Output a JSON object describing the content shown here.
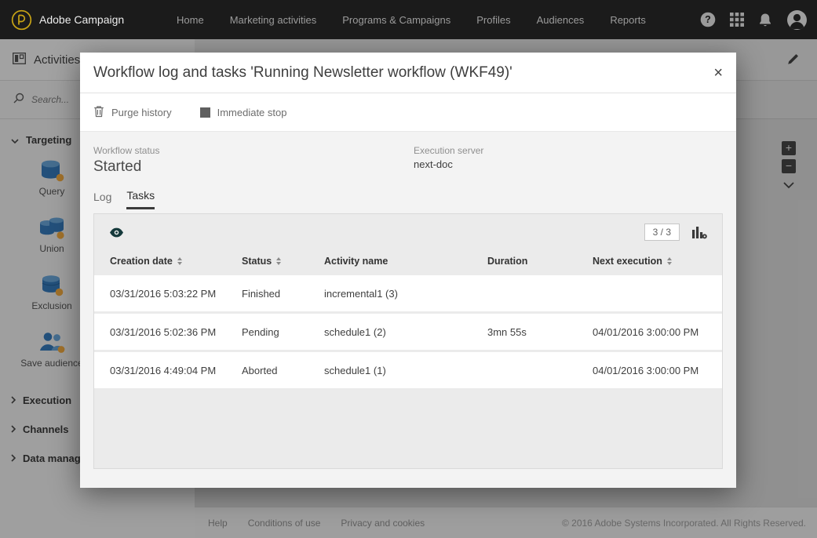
{
  "colors": {
    "topbar_bg": "#1b1b1b",
    "logo_gold": "#c8a415",
    "accent_blue": "#2e74b5",
    "accent_orange": "#f0a63a",
    "tab_active_underline": "#3a3a3a"
  },
  "topbar": {
    "brand": "Adobe Campaign",
    "nav": [
      {
        "label": "Home"
      },
      {
        "label": "Marketing activities"
      },
      {
        "label": "Programs & Campaigns"
      },
      {
        "label": "Profiles"
      },
      {
        "label": "Audiences"
      },
      {
        "label": "Reports"
      }
    ]
  },
  "sidebar": {
    "title": "Activities",
    "search_placeholder": "Search...",
    "targeting": {
      "label": "Targeting",
      "items": [
        {
          "label": "Query",
          "icon": "query-icon"
        },
        {
          "label": "Union",
          "icon": "union-icon"
        },
        {
          "label": "Exclusion",
          "icon": "exclusion-icon"
        },
        {
          "label": "Save audience",
          "icon": "save-audience-icon"
        }
      ]
    },
    "collapsed_sections": [
      {
        "label": "Execution"
      },
      {
        "label": "Channels"
      },
      {
        "label": "Data management"
      }
    ]
  },
  "canvas": {
    "zoom_in": "+",
    "zoom_out": "−"
  },
  "modal": {
    "title": "Workflow log and tasks 'Running Newsletter workflow (WKF49)'",
    "close_label": "×",
    "actions": {
      "purge": "Purge history",
      "stop": "Immediate stop"
    },
    "status": {
      "workflow_status_label": "Workflow status",
      "workflow_status_value": "Started",
      "execution_server_label": "Execution server",
      "execution_server_value": "next-doc"
    },
    "tabs": [
      {
        "label": "Log",
        "active": false
      },
      {
        "label": "Tasks",
        "active": true
      }
    ],
    "table": {
      "count_badge": "3 / 3",
      "columns": [
        {
          "label": "Creation date",
          "sortable": true
        },
        {
          "label": "Status",
          "sortable": true
        },
        {
          "label": "Activity name",
          "sortable": false
        },
        {
          "label": "Duration",
          "sortable": false
        },
        {
          "label": "Next execution",
          "sortable": true
        }
      ],
      "rows": [
        {
          "creation_date": "03/31/2016 5:03:22 PM",
          "status": "Finished",
          "activity": "incremental1 (3)",
          "duration": "",
          "next_execution": ""
        },
        {
          "creation_date": "03/31/2016 5:02:36 PM",
          "status": "Pending",
          "activity": "schedule1 (2)",
          "duration": "3mn 55s",
          "next_execution": "04/01/2016 3:00:00 PM"
        },
        {
          "creation_date": "03/31/2016 4:49:04 PM",
          "status": "Aborted",
          "activity": "schedule1 (1)",
          "duration": "",
          "next_execution": "04/01/2016 3:00:00 PM"
        }
      ]
    }
  },
  "footer": {
    "links": [
      "Help",
      "Conditions of use",
      "Privacy and cookies"
    ],
    "copyright": "© 2016 Adobe Systems Incorporated. All Rights Reserved."
  }
}
